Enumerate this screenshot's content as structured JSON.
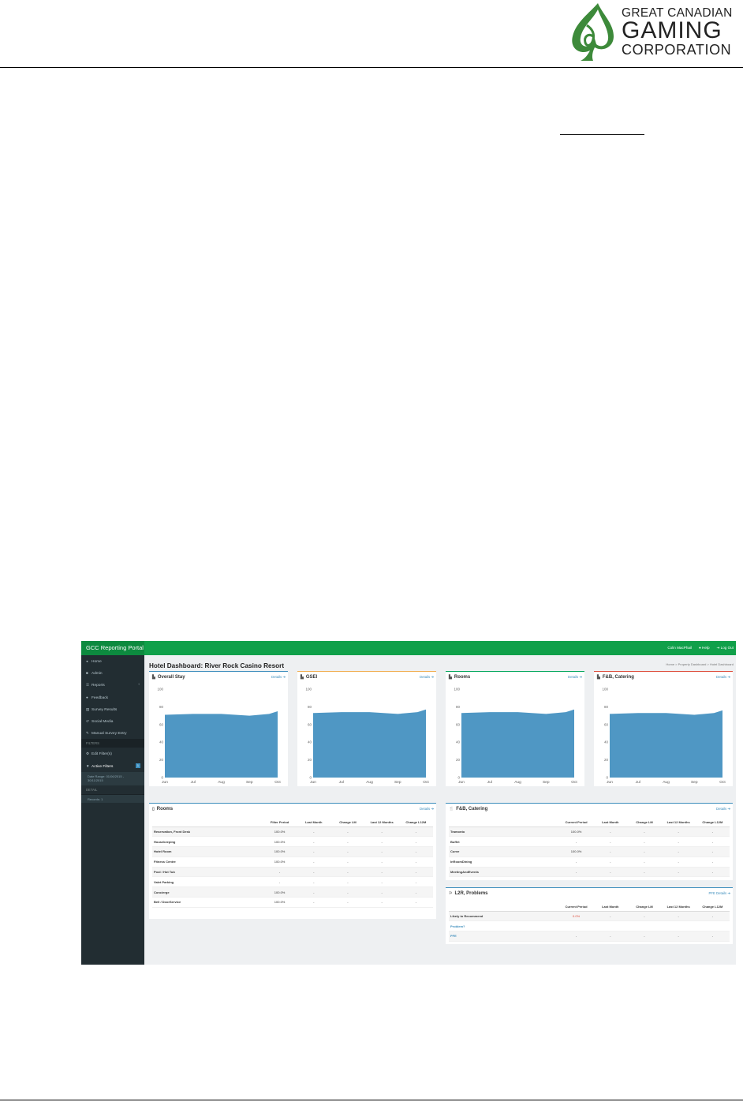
{
  "document": {
    "logo": {
      "line1": "GREAT CANADIAN",
      "line2": "GAMING",
      "line3": "CORPORATION",
      "mark": "spade-leaf-logo",
      "color": "#3d8a3a"
    }
  },
  "portal": {
    "brand": "GCC Reporting Portal",
    "user": "Colin MacPhail",
    "help": "Help",
    "logout": "Log Out",
    "colors": {
      "topbar": "#10a04a",
      "sidebar": "#222d32",
      "chart_fill": "#4f97c4",
      "link": "#3c8dbc"
    },
    "sidebar": {
      "items": [
        {
          "icon": "home-icon",
          "glyph": "◂",
          "label": "Home"
        },
        {
          "icon": "lock-icon",
          "glyph": "🔒",
          "label": "Admin"
        },
        {
          "icon": "list-icon",
          "glyph": "☰",
          "label": "Reports",
          "chevron": "‹"
        },
        {
          "icon": "comment-icon",
          "glyph": "●",
          "label": "Feedback"
        },
        {
          "icon": "table-icon",
          "glyph": "▤",
          "label": "Survey Results"
        },
        {
          "icon": "share-icon",
          "glyph": "↺",
          "label": "Social Media"
        },
        {
          "icon": "edit-icon",
          "glyph": "✎",
          "label": "Manual Survey Entry"
        }
      ],
      "filters_header": "FILTERS",
      "edit_filters": {
        "icon": "gear-icon",
        "glyph": "⚙",
        "label": "Edit Filter(s)"
      },
      "active_filters": {
        "icon": "filter-icon",
        "glyph": "▼",
        "label": "Active Filters",
        "badge": "1"
      },
      "date_range": "Date Range: 01/06/2015 - 30/11/2015",
      "detail_header": "DETAIL",
      "detail_item": "Records: 1"
    },
    "page_title": "Hotel Dashboard: River Rock Casino Resort",
    "breadcrumb": [
      "Home",
      "Property Dashboard",
      "Hotel Dashboard"
    ],
    "details_label": "Details",
    "pfe_details_label": "PFE Details"
  },
  "chart_data": [
    {
      "type": "area",
      "title": "Overall Stay",
      "accent": "#3c8dbc",
      "x": [
        "Jun",
        "Jul",
        "Aug",
        "Sep",
        "Oct"
      ],
      "y_ticks": [
        0,
        20,
        40,
        60,
        80,
        100
      ],
      "ylim": [
        0,
        100
      ],
      "values": [
        71,
        72,
        72,
        70,
        72,
        75
      ],
      "x_pos": [
        0,
        1,
        2,
        3,
        3.7,
        4
      ]
    },
    {
      "type": "area",
      "title": "GSEI",
      "accent": "#f0ad4e",
      "x": [
        "Jun",
        "Jul",
        "Aug",
        "Sep",
        "Oct"
      ],
      "y_ticks": [
        0,
        20,
        40,
        60,
        80,
        100
      ],
      "ylim": [
        0,
        100
      ],
      "values": [
        73,
        74,
        74,
        72,
        74,
        77
      ],
      "x_pos": [
        0,
        1,
        2,
        3,
        3.7,
        4
      ]
    },
    {
      "type": "area",
      "title": "Rooms",
      "accent": "#00a65a",
      "x": [
        "Jun",
        "Jul",
        "Aug",
        "Sep",
        "Oct"
      ],
      "y_ticks": [
        0,
        20,
        40,
        60,
        80,
        100
      ],
      "ylim": [
        0,
        100
      ],
      "values": [
        73,
        74,
        74,
        72,
        74,
        77
      ],
      "x_pos": [
        0,
        1,
        2,
        3,
        3.7,
        4
      ]
    },
    {
      "type": "area",
      "title": "F&B, Catering",
      "accent": "#dd4b39",
      "x": [
        "Jun",
        "Jul",
        "Aug",
        "Sep",
        "Oct"
      ],
      "y_ticks": [
        0,
        20,
        40,
        60,
        80,
        100
      ],
      "ylim": [
        0,
        100
      ],
      "values": [
        72,
        73,
        73,
        71,
        73,
        76
      ],
      "x_pos": [
        0,
        1,
        2,
        3,
        3.7,
        4
      ]
    }
  ],
  "rooms_table": {
    "title": "Rooms",
    "columns": [
      "",
      "Filter Period",
      "Last Month",
      "Change LM",
      "Last 12 Months",
      "Change L12M"
    ],
    "rows": [
      [
        "Reservation, Front Desk",
        "100.0%",
        "-",
        "-",
        "-",
        "-"
      ],
      [
        "Housekeeping",
        "100.0%",
        "-",
        "-",
        "-",
        "-"
      ],
      [
        "Hotel Room",
        "100.0%",
        "-",
        "-",
        "-",
        "-"
      ],
      [
        "Fitness Centre",
        "100.0%",
        "-",
        "-",
        "-",
        "-"
      ],
      [
        "Pool / Hot Tub",
        "-",
        "-",
        "-",
        "-",
        "-"
      ],
      [
        "Valet Parking",
        "-",
        "-",
        "-",
        "-",
        "-"
      ],
      [
        "Concierge",
        "100.0%",
        "-",
        "-",
        "-",
        "-"
      ],
      [
        "Bell / DoorService",
        "100.0%",
        "-",
        "-",
        "-",
        "-"
      ]
    ]
  },
  "fb_table": {
    "title": "F&B, Catering",
    "columns": [
      "",
      "Current Period",
      "Last Month",
      "Change LM",
      "Last 12 Months",
      "Change L12M"
    ],
    "rows": [
      [
        "Tramonto",
        "100.0%",
        "-",
        "-",
        "-",
        "-"
      ],
      [
        "Buffet",
        "-",
        "-",
        "-",
        "-",
        "-"
      ],
      [
        "Curve",
        "100.0%",
        "-",
        "-",
        "-",
        "-"
      ],
      [
        "InRoomDining",
        "-",
        "-",
        "-",
        "-",
        "-"
      ],
      [
        "MeetingAndEvents",
        "-",
        "-",
        "-",
        "-",
        "-"
      ]
    ]
  },
  "l2r_table": {
    "title": "L2R, Problems",
    "columns": [
      "",
      "Current Period",
      "Last Month",
      "Change LM",
      "Last 12 Months",
      "Change L12M"
    ],
    "rows": [
      [
        "Likely to Recommend",
        "0.0%",
        "-",
        "-",
        "-",
        "-"
      ],
      [
        "Problem?",
        "",
        "",
        "",
        "",
        ""
      ],
      [
        "PFE",
        "-",
        "-",
        "-",
        "-",
        "-"
      ]
    ]
  }
}
